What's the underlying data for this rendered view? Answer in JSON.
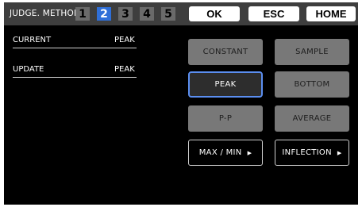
{
  "header": {
    "title": "JUDGE. METHOD",
    "method_numbers": [
      "1",
      "2",
      "3",
      "4",
      "5"
    ],
    "selected_method": "2",
    "ok_label": "OK",
    "esc_label": "ESC",
    "home_label": "HOME"
  },
  "info": {
    "current_label": "CURRENT",
    "current_value": "PEAK",
    "update_label": "UPDATE",
    "update_value": "PEAK"
  },
  "options": {
    "constant": "CONSTANT",
    "sample": "SAMPLE",
    "peak": "PEAK",
    "bottom": "BOTTOM",
    "pp": "P-P",
    "average": "AVERAGE",
    "maxmin": "MAX / MIN",
    "inflection": "INFLECTION",
    "submenu_arrow": "▶",
    "selected": "PEAK"
  },
  "colors": {
    "background": "#000000",
    "header_bar": "#3e3e3e",
    "active_number": "#2f6fd8",
    "selected_border": "#5b8ef0",
    "inactive_button": "#787878"
  }
}
